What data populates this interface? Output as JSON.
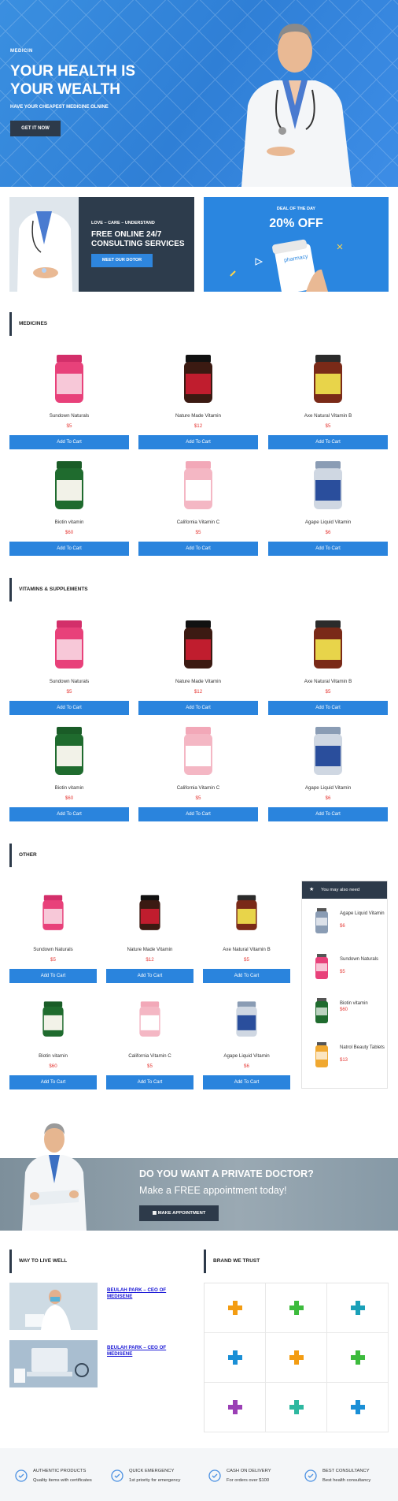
{
  "hero": {
    "brand": "MEDICIN",
    "title": "YOUR HEALTH IS YOUR WEALTH",
    "subtitle": "HAVE YOUR CHEAPEST MEDICINE OLNINE",
    "button": "GET IT NOW"
  },
  "banner_consult": {
    "tagline": "LOVE – CARE – UNDERSTAND",
    "title": "FREE ONLINE 24/7 CONSULTING SERVICES",
    "button": "MEET OUR DOTOR"
  },
  "banner_deal": {
    "label": "DEAL OF THE DAY",
    "title": "20% OFF",
    "bottle_label": "pharmacy"
  },
  "sections": [
    {
      "title": "MEDICINES"
    },
    {
      "title": "VITAMINS & SUPPLEMENTS"
    },
    {
      "title": "OTHER"
    }
  ],
  "products": [
    {
      "name": "Sundown Naturals",
      "price": "$5",
      "icon": "pink-gummy-jar"
    },
    {
      "name": "Nature Made Vitamin",
      "price": "$12",
      "icon": "dark-syrup-bottle"
    },
    {
      "name": "Axe Natural Vitamin B",
      "price": "$5",
      "icon": "amber-pill-bottle"
    },
    {
      "name": "Biotin vitamin",
      "price": "$60",
      "icon": "green-pill-bottle"
    },
    {
      "name": "California Vitamin C",
      "price": "$5",
      "icon": "pink-pill-bottle"
    },
    {
      "name": "Agape Liquid Vitamin",
      "price": "$6",
      "icon": "blue-pill-bottle"
    }
  ],
  "add_to_cart": "Add To Cart",
  "sidebar": {
    "title": "You may also need",
    "items": [
      {
        "name": "Agape Liquid Vitamin",
        "price": "$6"
      },
      {
        "name": "Sundown Naturals",
        "price": "$5"
      },
      {
        "name": "Biotin vitamin",
        "price": "$60"
      },
      {
        "name": "Natrol Beauty Tablets",
        "price": "$13"
      }
    ]
  },
  "appointment": {
    "question": "DO YOU WANT A PRIVATE DOCTOR?",
    "subtitle": "Make a FREE appointment today!",
    "button": "MAKE APPOINTMENT"
  },
  "blog": {
    "title": "WAY TO LIVE WELL",
    "posts": [
      {
        "title": "BEULAH PARK – CEO OF MEDISENE"
      },
      {
        "title": "BEULAH PARK – CEO OF MEDISENE"
      }
    ]
  },
  "brands": {
    "title": "BRAND WE TRUST",
    "colors": [
      "#f39c12",
      "#3dbb3d",
      "#1aa0b8",
      "#1a8fd6",
      "#f39c12",
      "#3dbb3d",
      "#9b3fb5",
      "#2eb8a0",
      "#1a8fd6"
    ]
  },
  "features": [
    {
      "title": "AUTHENTIC PRODUCTS",
      "desc": "Quality items with certificates",
      "icon": "heart-hand-icon"
    },
    {
      "title": "QUICK EMERGENCY",
      "desc": "1st priority for emergency",
      "icon": "syringe-icon"
    },
    {
      "title": "CASH ON DELIVERY",
      "desc": "For orders over $100",
      "icon": "bottle-icon"
    },
    {
      "title": "BEST CONSULTANCY",
      "desc": "Best health consultancy",
      "icon": "bandage-icon"
    }
  ]
}
